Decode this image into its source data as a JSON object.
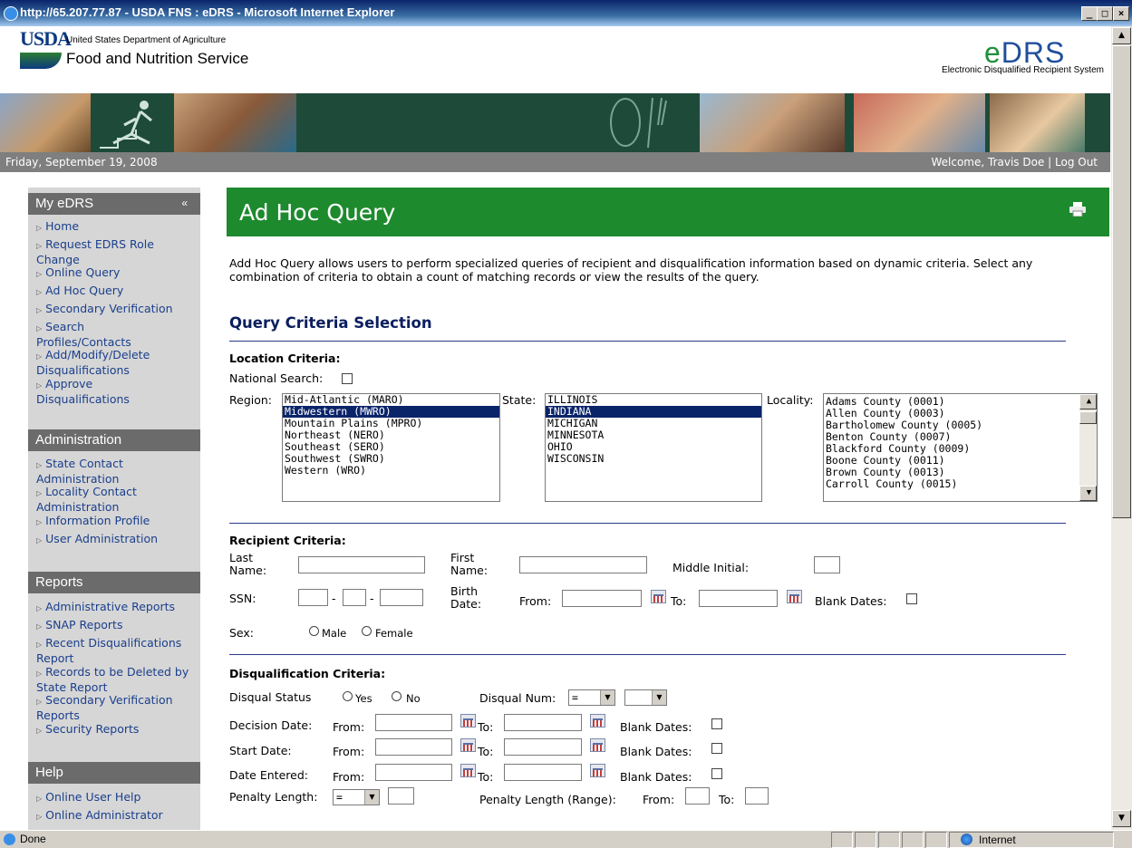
{
  "window": {
    "title": "http://65.207.77.87 - USDA FNS : eDRS - Microsoft Internet Explorer",
    "min": "_",
    "max": "□",
    "close": "×"
  },
  "header": {
    "usda": "USDA",
    "dept": "United States Department of Agriculture",
    "agency": "Food and Nutrition Service",
    "logo_e": "e",
    "logo_drs": "DRS",
    "logo_sub": "Electronic Disqualified Recipient System"
  },
  "datebar": {
    "date": "Friday, September 19, 2008",
    "welcome": "Welcome, Travis Doe | Log Out"
  },
  "sidebar": {
    "my_edrs": "My eDRS",
    "collapse": "«",
    "my_items": [
      {
        "label": "Home"
      },
      {
        "label": "Request EDRS Role Change"
      },
      {
        "label": "Online Query"
      },
      {
        "label": "Ad Hoc Query"
      },
      {
        "label": "Secondary Verification"
      },
      {
        "label": "Search Profiles/Contacts"
      },
      {
        "label": "Add/Modify/Delete Disqualifications"
      },
      {
        "label": "Approve Disqualifications"
      }
    ],
    "admin": "Administration",
    "admin_items": [
      {
        "label": "State Contact Administration"
      },
      {
        "label": "Locality Contact Administration"
      },
      {
        "label": "Information Profile"
      },
      {
        "label": "User Administration"
      }
    ],
    "reports": "Reports",
    "report_items": [
      {
        "label": "Administrative Reports"
      },
      {
        "label": "SNAP Reports"
      },
      {
        "label": "Recent Disqualifications Report"
      },
      {
        "label": "Records to be Deleted by State Report"
      },
      {
        "label": "Secondary Verification Reports"
      },
      {
        "label": "Security Reports"
      }
    ],
    "help": "Help",
    "help_items": [
      {
        "label": "Online User Help"
      },
      {
        "label": "Online Administrator"
      }
    ]
  },
  "main": {
    "title": "Ad Hoc Query",
    "intro": "Add Hoc Query allows users to perform specialized queries of recipient and disqualification information based on dynamic criteria. Select any combination of criteria to obtain a count of matching records or view the results of the query.",
    "section_title": "Query Criteria Selection",
    "location": {
      "heading": "Location Criteria:",
      "national": "National Search:",
      "region_label": "Region:",
      "regions": [
        "Mid-Atlantic (MARO)",
        "Midwestern (MWRO)",
        "Mountain Plains (MPRO)",
        "Northeast (NERO)",
        "Southeast (SERO)",
        "Southwest (SWRO)",
        "Western (WRO)"
      ],
      "region_selected": 1,
      "state_label": "State:",
      "states": [
        "ILLINOIS",
        "INDIANA",
        "MICHIGAN",
        "MINNESOTA",
        "OHIO",
        "WISCONSIN"
      ],
      "state_selected": 1,
      "locality_label": "Locality:",
      "localities": [
        "Adams County (0001)",
        "Allen County (0003)",
        "Bartholomew County (0005)",
        "Benton County (0007)",
        "Blackford County (0009)",
        "Boone County (0011)",
        "Brown County (0013)",
        "Carroll County (0015)"
      ]
    },
    "recipient": {
      "heading": "Recipient Criteria:",
      "last_name": "Last\nName:",
      "first_name": "First\nName:",
      "middle": "Middle Initial:",
      "ssn": "SSN:",
      "dash": "-",
      "birth": "Birth\nDate:",
      "from": "From:",
      "to": "To:",
      "blank": "Blank Dates:",
      "sex": "Sex:",
      "male": "Male",
      "female": "Female"
    },
    "disqual": {
      "heading": "Disqualification Criteria:",
      "status": "Disqual Status",
      "yes": "Yes",
      "no": "No",
      "num": "Disqual Num:",
      "num_op": "=",
      "decision": "Decision Date:",
      "start": "Start Date:",
      "entered": "Date Entered:",
      "from": "From:",
      "to": "To:",
      "blank": "Blank Dates:",
      "penalty": "Penalty Length:",
      "penalty_op": "=",
      "penalty_range": "Penalty Length (Range):",
      "range_from": "From:",
      "range_to": "To:"
    }
  },
  "status": {
    "done": "Done",
    "zone": "Internet"
  }
}
